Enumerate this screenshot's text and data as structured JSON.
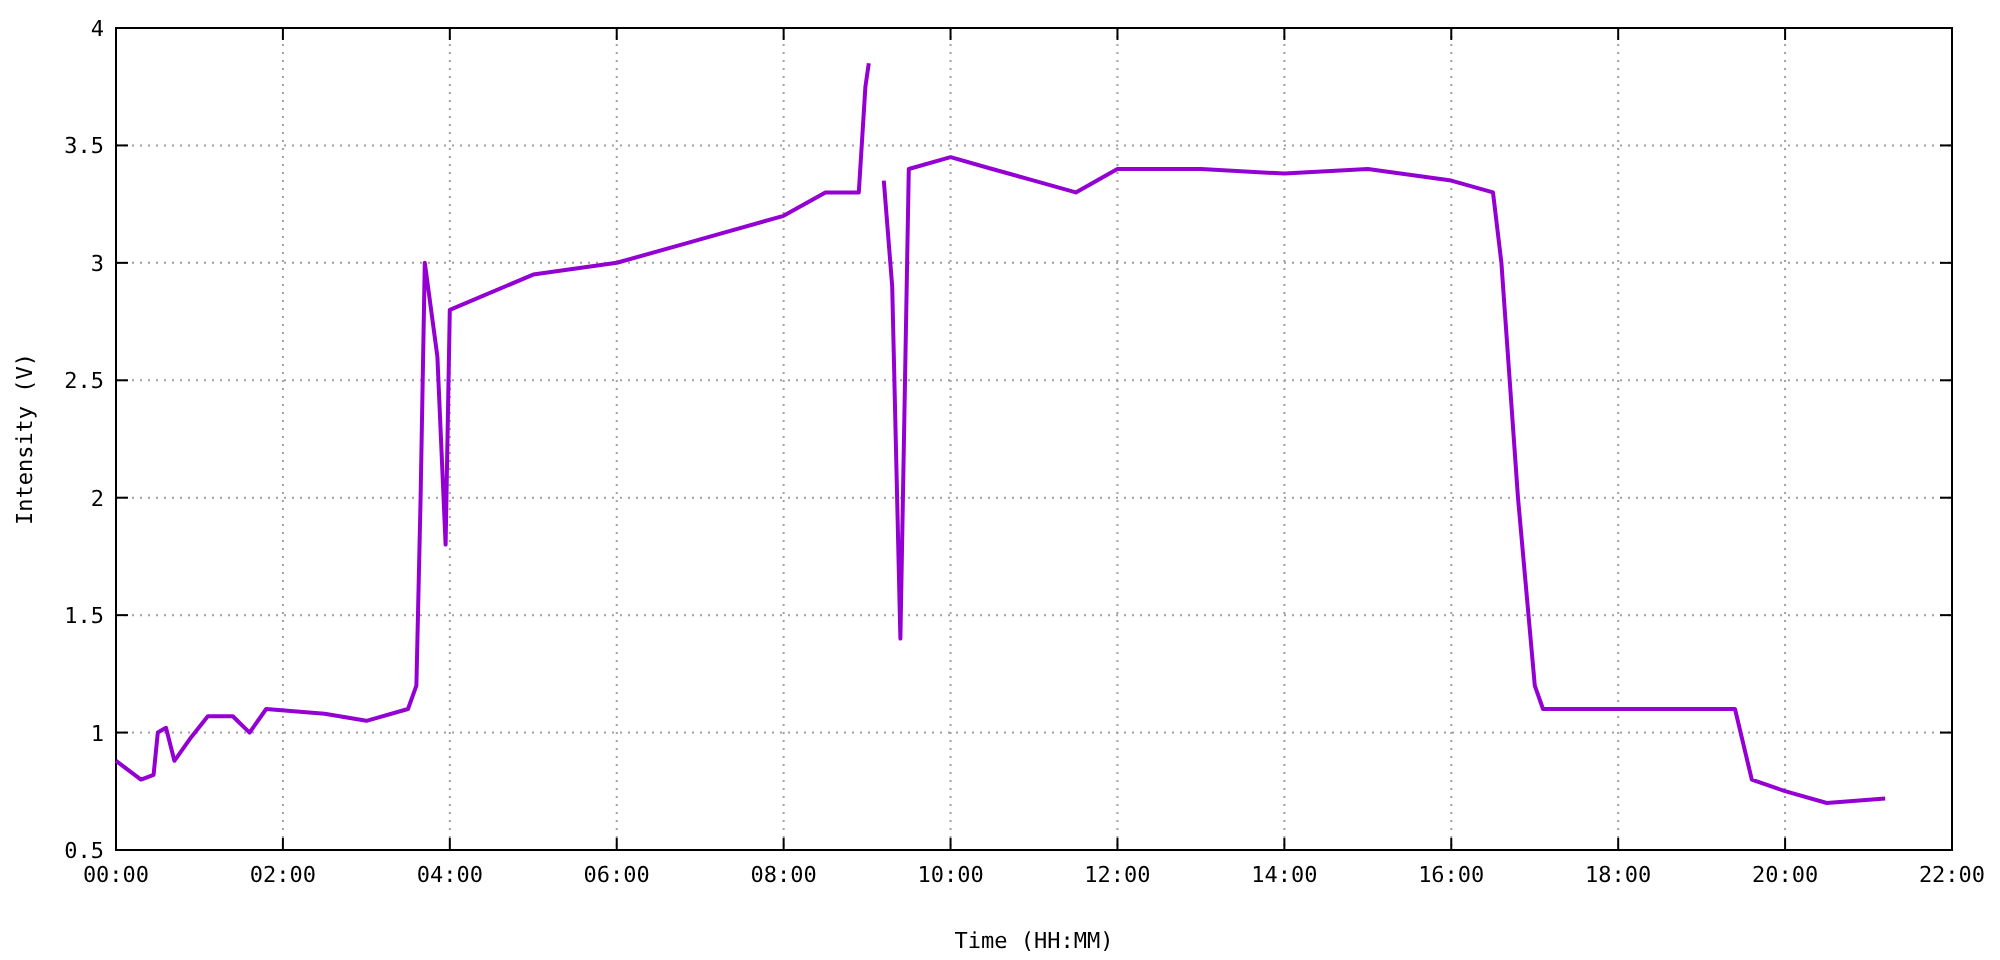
{
  "chart_data": {
    "type": "line",
    "grid": true,
    "xlabel": "Time (HH:MM)",
    "ylabel": "Intensity (V)",
    "xlim": [
      0,
      22
    ],
    "ylim": [
      0.5,
      4
    ],
    "xticks": [
      {
        "value": 0,
        "label": "00:00"
      },
      {
        "value": 2,
        "label": "02:00"
      },
      {
        "value": 4,
        "label": "04:00"
      },
      {
        "value": 6,
        "label": "06:00"
      },
      {
        "value": 8,
        "label": "08:00"
      },
      {
        "value": 10,
        "label": "10:00"
      },
      {
        "value": 12,
        "label": "12:00"
      },
      {
        "value": 14,
        "label": "14:00"
      },
      {
        "value": 16,
        "label": "16:00"
      },
      {
        "value": 18,
        "label": "18:00"
      },
      {
        "value": 20,
        "label": "20:00"
      },
      {
        "value": 22,
        "label": "22:00"
      }
    ],
    "yticks": [
      {
        "value": 0.5,
        "label": "0.5"
      },
      {
        "value": 1,
        "label": "1"
      },
      {
        "value": 1.5,
        "label": "1.5"
      },
      {
        "value": 2,
        "label": "2"
      },
      {
        "value": 2.5,
        "label": "2.5"
      },
      {
        "value": 3,
        "label": "3"
      },
      {
        "value": 3.5,
        "label": "3.5"
      },
      {
        "value": 4,
        "label": "4"
      }
    ],
    "x": [
      0,
      0.3,
      0.45,
      0.5,
      0.6,
      0.7,
      0.9,
      1.1,
      1.4,
      1.6,
      1.8,
      2.5,
      3.0,
      3.5,
      3.6,
      3.65,
      3.7,
      3.85,
      3.95,
      4.0,
      5,
      6,
      7,
      8,
      8.5,
      8.9,
      8.98,
      9.02,
      9.05,
      9.2,
      9.3,
      9.4,
      9.5,
      10,
      10.5,
      11,
      11.5,
      12,
      13,
      14,
      15,
      16,
      16.5,
      16.6,
      16.8,
      17,
      17.1,
      18,
      19,
      19.4,
      19.6,
      20,
      20.5,
      21.2
    ],
    "series": [
      {
        "color": "#9400d3",
        "values": [
          0.88,
          0.8,
          0.82,
          1.0,
          1.02,
          0.88,
          0.98,
          1.07,
          1.07,
          1.0,
          1.1,
          1.08,
          1.05,
          1.1,
          1.2,
          2.0,
          3.0,
          2.6,
          1.8,
          2.8,
          2.95,
          3.0,
          3.1,
          3.2,
          3.3,
          3.3,
          3.75,
          3.85,
          null,
          3.35,
          2.9,
          1.4,
          3.4,
          3.45,
          3.4,
          3.35,
          3.3,
          3.4,
          3.4,
          3.38,
          3.4,
          3.35,
          3.3,
          3.0,
          2.0,
          1.2,
          1.1,
          1.1,
          1.1,
          1.1,
          0.8,
          0.75,
          0.7,
          0.72
        ]
      }
    ]
  }
}
